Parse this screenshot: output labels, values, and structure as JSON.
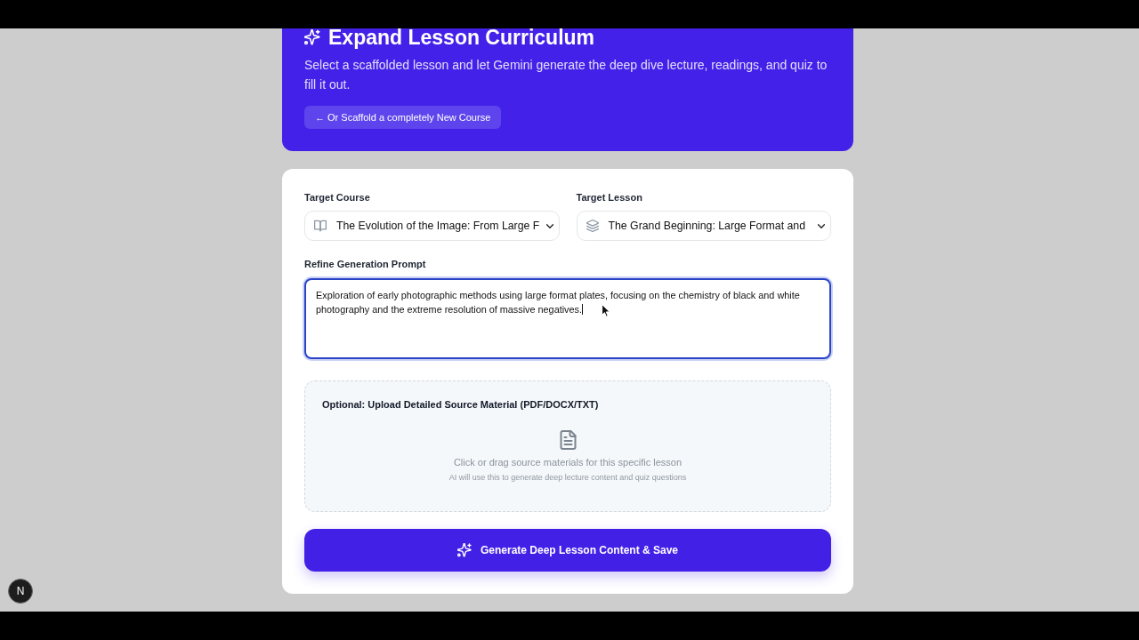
{
  "header": {
    "title": "Expand Lesson Curriculum",
    "description": "Select a scaffolded lesson and let Gemini generate the deep dive lecture, readings, and quiz to fill it out.",
    "link_button": "← Or Scaffold a completely New Course"
  },
  "form": {
    "selects": [
      {
        "kind": "course",
        "label": "Target Course",
        "value": "The Evolution of the Image: From Large F"
      },
      {
        "kind": "lesson",
        "label": "Target Lesson",
        "value": "The Grand Beginning: Large Format and"
      }
    ],
    "prompt": {
      "label": "Refine Generation Prompt",
      "value": "Exploration of early photographic methods using large format plates, focusing on the chemistry of black and white photography and the extreme resolution of massive negatives.",
      "focused": true
    },
    "upload": {
      "title": "Optional: Upload Detailed Source Material (PDF/DOCX/TXT)",
      "hint": "Click or drag source materials for this specific lesson",
      "subhint": "AI will use this to generate deep lecture content and quiz questions"
    },
    "submit_button": "Generate Deep Lesson Content & Save"
  },
  "dev_badge": {
    "label": "N"
  }
}
